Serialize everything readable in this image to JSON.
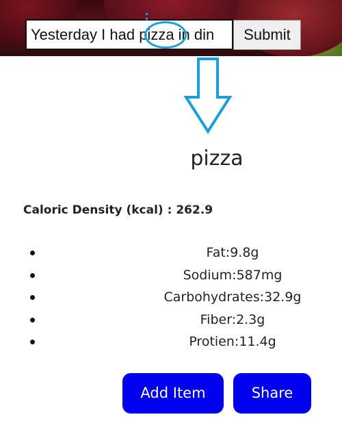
{
  "search": {
    "value": "Yesterday I had pizza in din",
    "submit_label": "Submit"
  },
  "food": {
    "title": "pizza",
    "caloric_label": "Caloric Density (kcal) : 262.9"
  },
  "nutrients": [
    {
      "text": "Fat:9.8g"
    },
    {
      "text": "Sodium:587mg"
    },
    {
      "text": "Carbohydrates:32.9g"
    },
    {
      "text": "Fiber:2.3g"
    },
    {
      "text": "Protien:11.4g"
    }
  ],
  "actions": {
    "add_item_label": "Add Item",
    "share_label": "Share"
  },
  "colors": {
    "accent_button": "#0000ee",
    "annotation": "#1a9fdc"
  },
  "icons": {
    "annotation_arrow": "down-arrow-icon",
    "annotation_circle": "highlight-circle"
  }
}
